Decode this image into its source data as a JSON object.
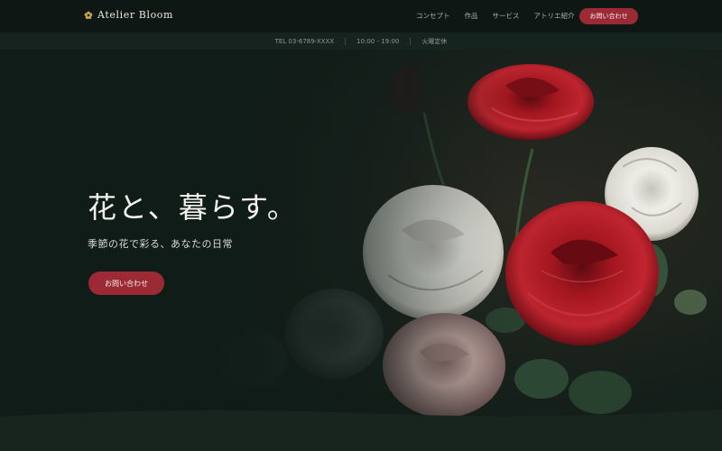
{
  "header": {
    "brand": "Atelier Bloom",
    "brand_icon": "flower-icon",
    "menu": [
      "コンセプト",
      "作品",
      "サービス",
      "アトリエ紹介"
    ],
    "cta_label": "お問い合わせ"
  },
  "infobar": {
    "phone": "TEL 03-6789-XXXX",
    "hours": "10:00 - 19:00",
    "closed": "火曜定休"
  },
  "hero": {
    "title": "花と、暮らす。",
    "subtitle": "季節の花で彩る、あなたの日常",
    "cta_label": "お問い合わせ"
  },
  "colors": {
    "accent": "#9b2a35",
    "background": "#101c18",
    "nav_background": "#0e1714",
    "infobar_background": "#16241f",
    "rose_red": "#a8161f",
    "rose_white": "#e9e8e2"
  }
}
